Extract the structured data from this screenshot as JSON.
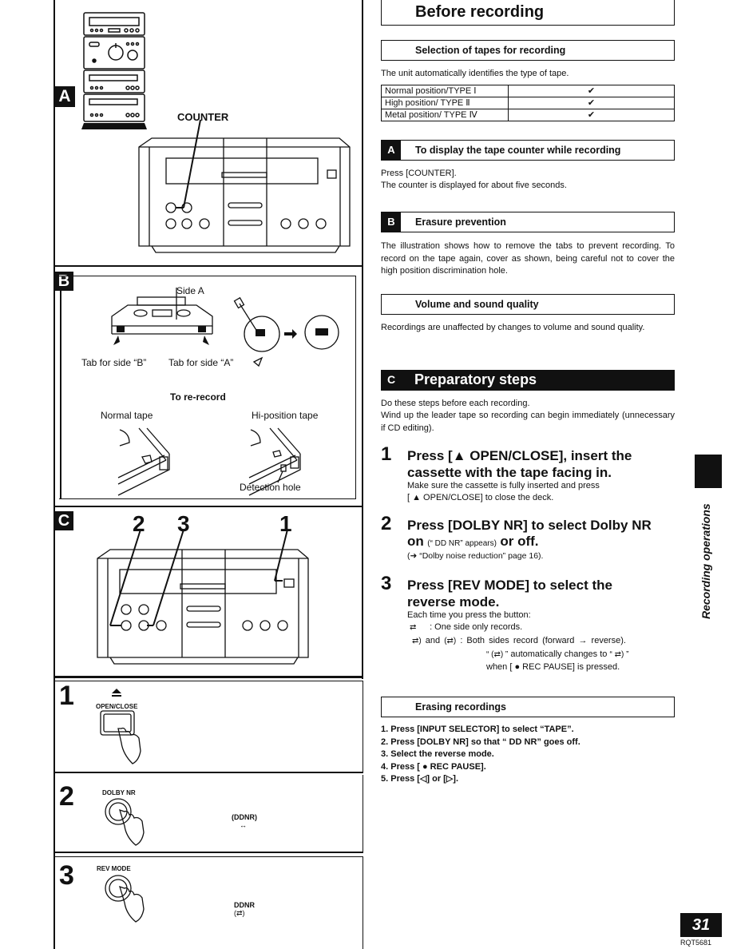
{
  "left": {
    "sectionA": {
      "badge": "A",
      "counter_label": "COUNTER"
    },
    "sectionB": {
      "badge": "B",
      "side_a_label": "Side A",
      "tab_b_label": "Tab for side “B”",
      "tab_a_label": "Tab for side “A”",
      "rerecord_title": "To re-record",
      "normal_tape_label": "Normal tape",
      "hi_position_label": "Hi-position tape",
      "detection_hole_label": "Detection hole"
    },
    "sectionC": {
      "badge": "C",
      "callouts": [
        "2",
        "3",
        "1"
      ]
    },
    "steps": [
      {
        "number": "1",
        "button_label": "OPEN/CLOSE",
        "button_icon": "eject-icon"
      },
      {
        "number": "2",
        "button_label": "DOLBY NR",
        "display_top": "(DDNR)",
        "display_bottom": "↔"
      },
      {
        "number": "3",
        "button_label": "REV MODE",
        "display_top": "DDNR",
        "display_bottom": "(⇄)"
      }
    ]
  },
  "right": {
    "page_title": "Before recording",
    "tape_selection": {
      "heading": "Selection of tapes for recording",
      "intro": "The unit automatically identifies the type of tape.",
      "rows": [
        {
          "type": "Normal position/TYPE Ⅰ",
          "supported": "✔"
        },
        {
          "type": "High position/ TYPE Ⅱ",
          "supported": "✔"
        },
        {
          "type": "Metal position/ TYPE Ⅳ",
          "supported": "✔"
        }
      ]
    },
    "counter": {
      "badge": "A",
      "heading": "To display the tape counter while recording",
      "lines": [
        "Press [COUNTER].",
        "The counter is displayed for about five seconds."
      ]
    },
    "erasure": {
      "badge": "B",
      "heading": "Erasure prevention",
      "text": "The illustration shows how to remove the tabs to prevent recording. To record on the tape again, cover as shown, being careful not to cover the high position discrimination hole."
    },
    "volume": {
      "heading": "Volume and sound quality",
      "text": "Recordings are unaffected by changes to volume and sound quality."
    },
    "preparatory": {
      "badge": "C",
      "heading": "Preparatory steps",
      "line1": "Do these steps before each recording.",
      "line2": "Wind up the leader tape so recording can begin immediately (unnecessary if CD editing)."
    },
    "steps": [
      {
        "number": "1",
        "title_line1": "Press [▲ OPEN/CLOSE], insert the",
        "title_line2": "cassette with the tape facing in.",
        "body_line1": "Make sure the cassette is fully inserted and press",
        "body_line2": "[ ▲  OPEN/CLOSE] to close the deck."
      },
      {
        "number": "2",
        "title_line1": "Press [DOLBY NR] to select Dolby NR",
        "title_on": "on",
        "title_small": "(“ DD NR” appears)",
        "title_off": "or off.",
        "body_line1": "(➜ “Dolby noise reduction” page 16)."
      },
      {
        "number": "3",
        "title_line1": "Press [REV MODE] to select the",
        "title_line2": "reverse mode.",
        "body_line1": "Each time you press the button:",
        "mode1": ": One side only records.",
        "mode2_and": "and",
        "mode2": ": Both sides record (forward → reverse).",
        "mode3a": "automatically changes to",
        "mode3b": "when [ ● REC PAUSE] is pressed."
      }
    ],
    "erasing": {
      "heading": "Erasing recordings",
      "items": [
        "1. Press [INPUT SELECTOR] to select “TAPE”.",
        "2. Press [DOLBY NR] so that “ DD  NR” goes off.",
        "3. Select the reverse mode.",
        "4. Press [ ● REC PAUSE].",
        "5. Press [◁] or [▷]."
      ]
    },
    "side_label": "Recording operations",
    "page_number": "31",
    "doc_code": "RQT5681"
  }
}
